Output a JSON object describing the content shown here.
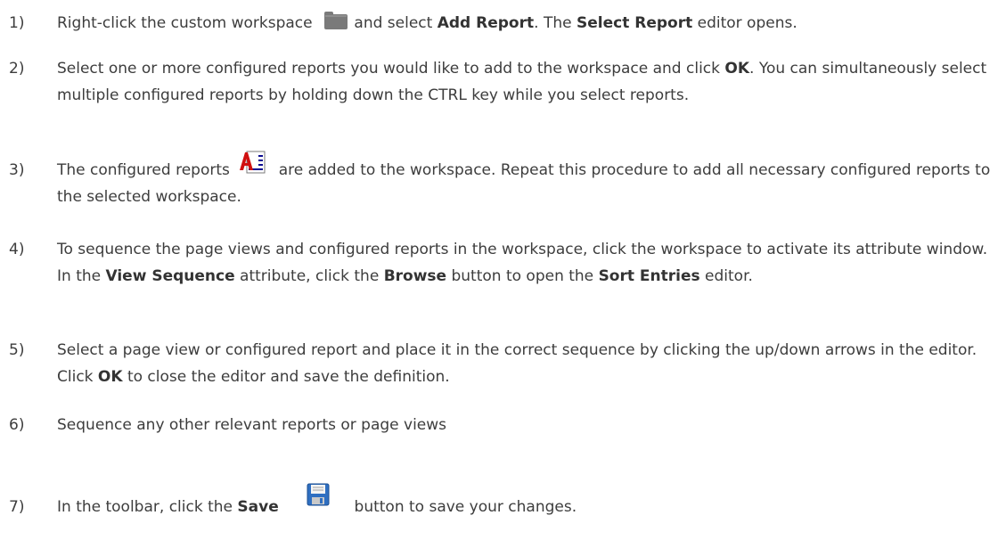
{
  "steps": [
    {
      "number": "1)",
      "parts": [
        "Right-click the custom workspace",
        "and select",
        "Add Report",
        ". The",
        "Select Report",
        "editor opens."
      ]
    },
    {
      "number": "2)",
      "parts": [
        "Select one or more configured reports you would like to add to the workspace and click",
        "OK",
        ". You can simultaneously select multiple configured reports by holding down the CTRL key while you select reports."
      ]
    },
    {
      "number": "3)",
      "parts": [
        "The configured reports",
        "are added to the workspace. Repeat this procedure to add all necessary configured reports to the selected workspace."
      ]
    },
    {
      "number": "4)",
      "parts": [
        "To sequence the page views and configured reports in the workspace, click the workspace to activate its attribute window. In the",
        "View Sequence",
        "attribute, click the",
        "Browse",
        "button to open the",
        "Sort Entries",
        "editor."
      ]
    },
    {
      "number": "5)",
      "parts": [
        "Select a page view or configured report and place it in the correct sequence by clicking the up/down arrows in the editor. Click",
        "OK",
        "to close the editor and save the definition."
      ]
    },
    {
      "number": "6)",
      "parts": [
        "Sequence any other relevant reports or page views"
      ]
    },
    {
      "number": "7)",
      "parts": [
        "In the toolbar, click the",
        "Save",
        "button to save your changes."
      ]
    }
  ],
  "icons": {
    "workspace": "folder-icon",
    "report": "configured-report-icon",
    "save": "save-disk-icon"
  }
}
